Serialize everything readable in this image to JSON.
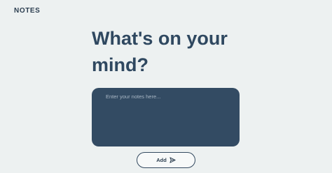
{
  "header": {
    "logo_text": "NOTES"
  },
  "main": {
    "heading": "What's on your mind?",
    "notes_input": {
      "placeholder": "Enter your notes here...",
      "value": ""
    },
    "add_button": {
      "label": "Add",
      "icon": "send-icon"
    }
  },
  "colors": {
    "background": "#edf1f1",
    "primary": "#334b63",
    "heading_text": "#2f4860"
  }
}
